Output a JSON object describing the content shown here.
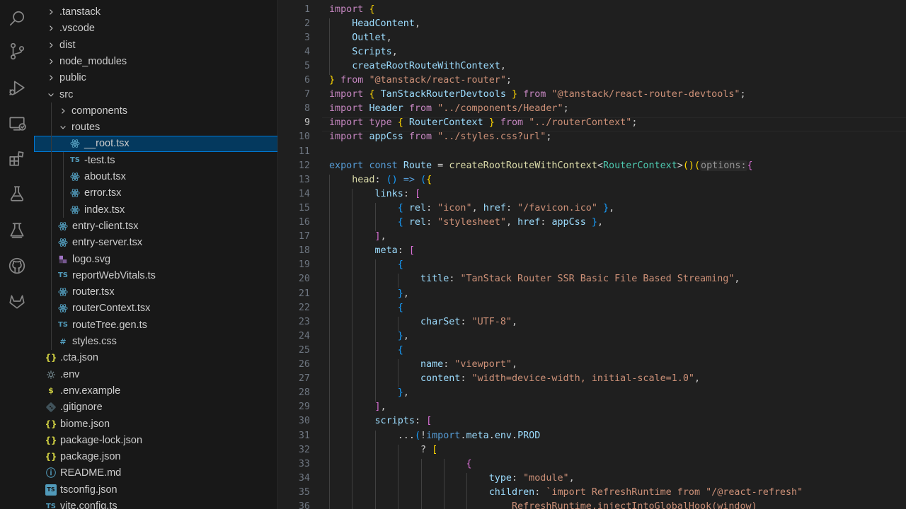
{
  "activity_bar": [
    {
      "name": "search-icon"
    },
    {
      "name": "source-control-icon"
    },
    {
      "name": "run-debug-icon"
    },
    {
      "name": "remote-explorer-icon"
    },
    {
      "name": "extensions-icon"
    },
    {
      "name": "testing-icon"
    },
    {
      "name": "lab-flask-icon"
    },
    {
      "name": "github-icon"
    },
    {
      "name": "gitlab-icon"
    }
  ],
  "explorer": {
    "items": [
      {
        "label": ".tanstack",
        "depth": 1,
        "kind": "folder",
        "open": false
      },
      {
        "label": ".vscode",
        "depth": 1,
        "kind": "folder",
        "open": false
      },
      {
        "label": "dist",
        "depth": 1,
        "kind": "folder",
        "open": false
      },
      {
        "label": "node_modules",
        "depth": 1,
        "kind": "folder",
        "open": false
      },
      {
        "label": "public",
        "depth": 1,
        "kind": "folder",
        "open": false
      },
      {
        "label": "src",
        "depth": 1,
        "kind": "folder",
        "open": true
      },
      {
        "label": "components",
        "depth": 2,
        "kind": "folder",
        "open": false
      },
      {
        "label": "routes",
        "depth": 2,
        "kind": "folder",
        "open": true
      },
      {
        "label": "__root.tsx",
        "depth": 3,
        "kind": "react",
        "selected": true
      },
      {
        "label": "-test.ts",
        "depth": 3,
        "kind": "ts"
      },
      {
        "label": "about.tsx",
        "depth": 3,
        "kind": "react"
      },
      {
        "label": "error.tsx",
        "depth": 3,
        "kind": "react"
      },
      {
        "label": "index.tsx",
        "depth": 3,
        "kind": "react"
      },
      {
        "label": "entry-client.tsx",
        "depth": 2,
        "kind": "react"
      },
      {
        "label": "entry-server.tsx",
        "depth": 2,
        "kind": "react"
      },
      {
        "label": "logo.svg",
        "depth": 2,
        "kind": "svg"
      },
      {
        "label": "reportWebVitals.ts",
        "depth": 2,
        "kind": "ts"
      },
      {
        "label": "router.tsx",
        "depth": 2,
        "kind": "react"
      },
      {
        "label": "routerContext.tsx",
        "depth": 2,
        "kind": "react"
      },
      {
        "label": "routeTree.gen.ts",
        "depth": 2,
        "kind": "ts"
      },
      {
        "label": "styles.css",
        "depth": 2,
        "kind": "css"
      },
      {
        "label": ".cta.json",
        "depth": 1,
        "kind": "json"
      },
      {
        "label": ".env",
        "depth": 1,
        "kind": "gear"
      },
      {
        "label": ".env.example",
        "depth": 1,
        "kind": "dollar"
      },
      {
        "label": ".gitignore",
        "depth": 1,
        "kind": "git"
      },
      {
        "label": "biome.json",
        "depth": 1,
        "kind": "json"
      },
      {
        "label": "package-lock.json",
        "depth": 1,
        "kind": "json"
      },
      {
        "label": "package.json",
        "depth": 1,
        "kind": "json"
      },
      {
        "label": "README.md",
        "depth": 1,
        "kind": "info"
      },
      {
        "label": "tsconfig.json",
        "depth": 1,
        "kind": "tsconfig"
      },
      {
        "label": "vite.config.ts",
        "depth": 1,
        "kind": "ts"
      }
    ]
  },
  "icon_glyphs": {
    "ts": "TS",
    "json": "{}",
    "css": "#",
    "dollar": "$",
    "info": "ⓘ",
    "tsconfig": "TS"
  },
  "colors": {
    "ts": "#519aba",
    "react": "#519aba",
    "json": "#cbcb41",
    "css": "#519aba",
    "gear": "#6d8086",
    "dollar": "#cbcb41",
    "git": "#41535b",
    "info": "#519aba",
    "svg": "#a074c4",
    "tsconfig": "#519aba"
  },
  "editor": {
    "active_line": 9,
    "lines": [
      [
        [
          "kw",
          "import"
        ],
        [
          "pl",
          " "
        ],
        [
          "b1",
          "{"
        ]
      ],
      [
        [
          "pl",
          "    "
        ],
        [
          "vr",
          "HeadContent"
        ],
        [
          "pl",
          ","
        ]
      ],
      [
        [
          "pl",
          "    "
        ],
        [
          "vr",
          "Outlet"
        ],
        [
          "pl",
          ","
        ]
      ],
      [
        [
          "pl",
          "    "
        ],
        [
          "vr",
          "Scripts"
        ],
        [
          "pl",
          ","
        ]
      ],
      [
        [
          "pl",
          "    "
        ],
        [
          "vr",
          "createRootRouteWithContext"
        ],
        [
          "pl",
          ","
        ]
      ],
      [
        [
          "b1",
          "}"
        ],
        [
          "pl",
          " "
        ],
        [
          "kw",
          "from"
        ],
        [
          "pl",
          " "
        ],
        [
          "st",
          "\"@tanstack/react-router\""
        ],
        [
          "pl",
          ";"
        ]
      ],
      [
        [
          "kw",
          "import"
        ],
        [
          "pl",
          " "
        ],
        [
          "b1",
          "{"
        ],
        [
          "pl",
          " "
        ],
        [
          "vr",
          "TanStackRouterDevtools"
        ],
        [
          "pl",
          " "
        ],
        [
          "b1",
          "}"
        ],
        [
          "pl",
          " "
        ],
        [
          "kw",
          "from"
        ],
        [
          "pl",
          " "
        ],
        [
          "st",
          "\"@tanstack/react-router-devtools\""
        ],
        [
          "pl",
          ";"
        ]
      ],
      [
        [
          "kw",
          "import"
        ],
        [
          "pl",
          " "
        ],
        [
          "vr",
          "Header"
        ],
        [
          "pl",
          " "
        ],
        [
          "kw",
          "from"
        ],
        [
          "pl",
          " "
        ],
        [
          "st",
          "\"../components/Header\""
        ],
        [
          "pl",
          ";"
        ]
      ],
      [
        [
          "kw",
          "import"
        ],
        [
          "pl",
          " "
        ],
        [
          "kw",
          "type"
        ],
        [
          "pl",
          " "
        ],
        [
          "b1",
          "{"
        ],
        [
          "pl",
          " "
        ],
        [
          "vr",
          "RouterContext"
        ],
        [
          "pl",
          " "
        ],
        [
          "b1",
          "}"
        ],
        [
          "pl",
          " "
        ],
        [
          "kw",
          "from"
        ],
        [
          "pl",
          " "
        ],
        [
          "st",
          "\"../routerContext\""
        ],
        [
          "pl",
          ";"
        ]
      ],
      [
        [
          "kw",
          "import"
        ],
        [
          "pl",
          " "
        ],
        [
          "vr",
          "appCss"
        ],
        [
          "pl",
          " "
        ],
        [
          "kw",
          "from"
        ],
        [
          "pl",
          " "
        ],
        [
          "st",
          "\"../styles.css?url\""
        ],
        [
          "pl",
          ";"
        ]
      ],
      [],
      [
        [
          "kb",
          "export"
        ],
        [
          "pl",
          " "
        ],
        [
          "kb",
          "const"
        ],
        [
          "pl",
          " "
        ],
        [
          "vr",
          "Route"
        ],
        [
          "pl",
          " = "
        ],
        [
          "fn",
          "createRootRouteWithContext"
        ],
        [
          "pl",
          "<"
        ],
        [
          "ty",
          "RouterContext"
        ],
        [
          "pl",
          ">"
        ],
        [
          "b1",
          "()"
        ],
        [
          "b1",
          "("
        ],
        [
          "ih",
          "options:"
        ],
        [
          "b2",
          "{"
        ]
      ],
      [
        [
          "pl",
          "    "
        ],
        [
          "fn",
          "head"
        ],
        [
          "pl",
          ": "
        ],
        [
          "b3",
          "()"
        ],
        [
          "pl",
          " "
        ],
        [
          "kb",
          "=>"
        ],
        [
          "pl",
          " "
        ],
        [
          "b3",
          "("
        ],
        [
          "b1",
          "{"
        ]
      ],
      [
        [
          "pl",
          "        "
        ],
        [
          "vr",
          "links"
        ],
        [
          "pl",
          ": "
        ],
        [
          "b2",
          "["
        ]
      ],
      [
        [
          "pl",
          "            "
        ],
        [
          "b3",
          "{"
        ],
        [
          "pl",
          " "
        ],
        [
          "vr",
          "rel"
        ],
        [
          "pl",
          ": "
        ],
        [
          "st",
          "\"icon\""
        ],
        [
          "pl",
          ", "
        ],
        [
          "vr",
          "href"
        ],
        [
          "pl",
          ": "
        ],
        [
          "st",
          "\"/favicon.ico\""
        ],
        [
          "pl",
          " "
        ],
        [
          "b3",
          "}"
        ],
        [
          "pl",
          ","
        ]
      ],
      [
        [
          "pl",
          "            "
        ],
        [
          "b3",
          "{"
        ],
        [
          "pl",
          " "
        ],
        [
          "vr",
          "rel"
        ],
        [
          "pl",
          ": "
        ],
        [
          "st",
          "\"stylesheet\""
        ],
        [
          "pl",
          ", "
        ],
        [
          "vr",
          "href"
        ],
        [
          "pl",
          ": "
        ],
        [
          "vr",
          "appCss"
        ],
        [
          "pl",
          " "
        ],
        [
          "b3",
          "}"
        ],
        [
          "pl",
          ","
        ]
      ],
      [
        [
          "pl",
          "        "
        ],
        [
          "b2",
          "]"
        ],
        [
          "pl",
          ","
        ]
      ],
      [
        [
          "pl",
          "        "
        ],
        [
          "vr",
          "meta"
        ],
        [
          "pl",
          ": "
        ],
        [
          "b2",
          "["
        ]
      ],
      [
        [
          "pl",
          "            "
        ],
        [
          "b3",
          "{"
        ]
      ],
      [
        [
          "pl",
          "                "
        ],
        [
          "vr",
          "title"
        ],
        [
          "pl",
          ": "
        ],
        [
          "st",
          "\"TanStack Router SSR Basic File Based Streaming\""
        ],
        [
          "pl",
          ","
        ]
      ],
      [
        [
          "pl",
          "            "
        ],
        [
          "b3",
          "}"
        ],
        [
          "pl",
          ","
        ]
      ],
      [
        [
          "pl",
          "            "
        ],
        [
          "b3",
          "{"
        ]
      ],
      [
        [
          "pl",
          "                "
        ],
        [
          "vr",
          "charSet"
        ],
        [
          "pl",
          ": "
        ],
        [
          "st",
          "\"UTF-8\""
        ],
        [
          "pl",
          ","
        ]
      ],
      [
        [
          "pl",
          "            "
        ],
        [
          "b3",
          "}"
        ],
        [
          "pl",
          ","
        ]
      ],
      [
        [
          "pl",
          "            "
        ],
        [
          "b3",
          "{"
        ]
      ],
      [
        [
          "pl",
          "                "
        ],
        [
          "vr",
          "name"
        ],
        [
          "pl",
          ": "
        ],
        [
          "st",
          "\"viewport\""
        ],
        [
          "pl",
          ","
        ]
      ],
      [
        [
          "pl",
          "                "
        ],
        [
          "vr",
          "content"
        ],
        [
          "pl",
          ": "
        ],
        [
          "st",
          "\"width=device-width, initial-scale=1.0\""
        ],
        [
          "pl",
          ","
        ]
      ],
      [
        [
          "pl",
          "            "
        ],
        [
          "b3",
          "}"
        ],
        [
          "pl",
          ","
        ]
      ],
      [
        [
          "pl",
          "        "
        ],
        [
          "b2",
          "]"
        ],
        [
          "pl",
          ","
        ]
      ],
      [
        [
          "pl",
          "        "
        ],
        [
          "vr",
          "scripts"
        ],
        [
          "pl",
          ": "
        ],
        [
          "b2",
          "["
        ]
      ],
      [
        [
          "pl",
          "            ..."
        ],
        [
          "b3",
          "("
        ],
        [
          "pl",
          "!"
        ],
        [
          "kb",
          "import"
        ],
        [
          "pl",
          "."
        ],
        [
          "vr",
          "meta"
        ],
        [
          "pl",
          "."
        ],
        [
          "vr",
          "env"
        ],
        [
          "pl",
          "."
        ],
        [
          "vr",
          "PROD"
        ]
      ],
      [
        [
          "pl",
          "                ? "
        ],
        [
          "b1",
          "["
        ]
      ],
      [
        [
          "pl",
          "                        "
        ],
        [
          "b2",
          "{"
        ]
      ],
      [
        [
          "pl",
          "                            "
        ],
        [
          "vr",
          "type"
        ],
        [
          "pl",
          ": "
        ],
        [
          "st",
          "\"module\""
        ],
        [
          "pl",
          ","
        ]
      ],
      [
        [
          "pl",
          "                            "
        ],
        [
          "vr",
          "children"
        ],
        [
          "pl",
          ": "
        ],
        [
          "st",
          "`import RefreshRuntime from \"/@react-refresh\""
        ]
      ],
      [
        [
          "st",
          "                                RefreshRuntime.injectIntoGlobalHook(window)"
        ]
      ]
    ]
  }
}
